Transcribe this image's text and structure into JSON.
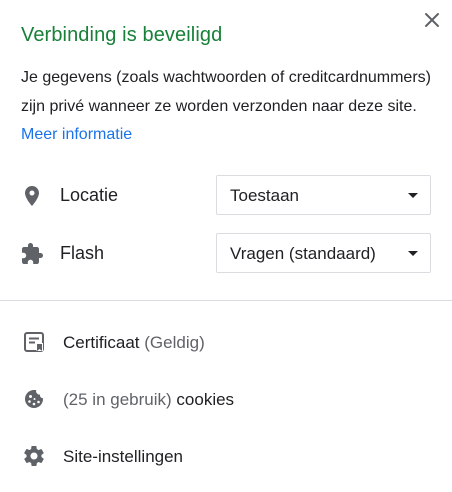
{
  "header": {
    "title": "Verbinding is beveiligd",
    "description": "Je gegevens (zoals wachtwoorden of creditcardnummers) zijn privé wanneer ze worden verzonden naar deze site.",
    "more_info": "Meer informatie",
    "close_icon": "close-icon"
  },
  "permissions": [
    {
      "label": "Locatie",
      "icon": "location-pin-icon",
      "value": "Toestaan"
    },
    {
      "label": "Flash",
      "icon": "puzzle-piece-icon",
      "value": "Vragen (standaard)"
    }
  ],
  "links": {
    "certificate": {
      "label": "Certificaat",
      "status": "(Geldig)",
      "icon": "certificate-icon"
    },
    "cookies": {
      "count": "(25 in gebruik)",
      "label": "cookies",
      "icon": "cookie-icon"
    },
    "site_settings": {
      "label": "Site-instellingen",
      "icon": "gear-icon"
    }
  },
  "colors": {
    "secure_green": "#188038",
    "link_blue": "#1a73e8",
    "icon_gray": "#5f6368",
    "divider": "#dadce0"
  }
}
